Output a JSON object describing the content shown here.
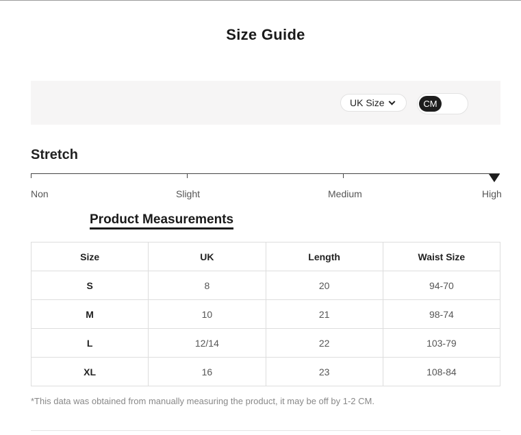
{
  "title": "Size Guide",
  "filters": {
    "size_system": "UK Size",
    "unit": "CM"
  },
  "stretch": {
    "title": "Stretch",
    "levels": [
      "Non",
      "Slight",
      "Medium",
      "High"
    ],
    "selected": "High"
  },
  "measurements": {
    "title": "Product Measurements",
    "headers": [
      "Size",
      "UK",
      "Length",
      "Waist Size"
    ],
    "rows": [
      [
        "S",
        "8",
        "20",
        "94-70"
      ],
      [
        "M",
        "10",
        "21",
        "98-74"
      ],
      [
        "L",
        "12/14",
        "22",
        "103-79"
      ],
      [
        "XL",
        "16",
        "23",
        "108-84"
      ]
    ]
  },
  "note": "*This data was obtained from manually measuring the product, it may be off by 1-2 CM."
}
